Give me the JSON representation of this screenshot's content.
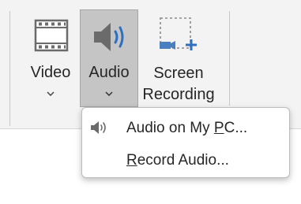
{
  "ribbon": {
    "video": {
      "label": "Video"
    },
    "audio": {
      "label": "Audio"
    },
    "screen_recording": {
      "label_line1": "Screen",
      "label_line2": "Recording"
    }
  },
  "audio_menu": {
    "items": [
      {
        "pre": "Audio on My ",
        "accel": "P",
        "post": "C...",
        "icon": "speaker-icon"
      },
      {
        "pre": "",
        "accel": "R",
        "post": "ecord Audio...",
        "icon": ""
      }
    ]
  },
  "colors": {
    "ribbon_bg": "#f3f3f3",
    "pressed_bg": "#c5c5c5",
    "accent_blue": "#2f6fbf",
    "icon_gray": "#6b6b6b"
  }
}
